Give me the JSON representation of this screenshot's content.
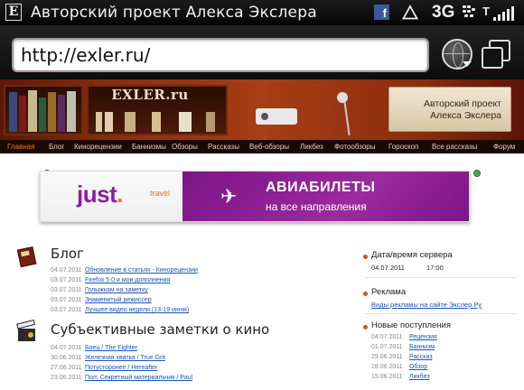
{
  "status_bar": {
    "app_title": "Авторский проект Алекса Экслера",
    "facebook_label": "f",
    "network_label": "3G"
  },
  "browser": {
    "url": "http://exler.ru/"
  },
  "header": {
    "logo": "EXLER.ru",
    "caption_line1": "Авторский проект",
    "caption_line2": "Алекса Экслера"
  },
  "nav": {
    "items": [
      {
        "label": "Главная",
        "active": true
      },
      {
        "label": "Блог"
      },
      {
        "label": "Кинорецензии"
      },
      {
        "label": "Баннизмы"
      },
      {
        "label": "Обзоры"
      },
      {
        "label": "Рассказы"
      },
      {
        "label": "Веб-обзоры"
      },
      {
        "label": "Ликбез"
      },
      {
        "label": "Фотообзоры"
      },
      {
        "label": "Гороскоп"
      },
      {
        "label": "Все рассказы"
      },
      {
        "label": "Форум"
      }
    ]
  },
  "ad": {
    "logo_main": "just",
    "logo_dot": ".",
    "logo_sub": "travel",
    "title": "АВИАБИЛЕТЫ",
    "subtitle": "на все направления",
    "plane_icon": "airplane-icon"
  },
  "blog": {
    "title": "Блог",
    "posts": [
      {
        "date": "04.07.2011",
        "title": "Обновление в статьях - Кинорецензии"
      },
      {
        "date": "03.07.2011",
        "title": "Firefox 5.0 и мои дополнения"
      },
      {
        "date": "03.07.2011",
        "title": "Голыжкам на заметку"
      },
      {
        "date": "03.07.2011",
        "title": "Знаменитый режиссер"
      },
      {
        "date": "03.07.2011",
        "title": "Лучшее видео недели (13-19 июня)"
      }
    ]
  },
  "movies": {
    "title": "Субъективные заметки о кино",
    "posts": [
      {
        "date": "04.07.2011",
        "title": "Боец / The Fighter"
      },
      {
        "date": "30.06.2011",
        "title": "Железная хватка / True Grit"
      },
      {
        "date": "27.06.2011",
        "title": "Потусторонее / Hereafter"
      },
      {
        "date": "23.06.2011",
        "title": "Пол: Секретный материальчик / Paul"
      }
    ]
  },
  "sidebar": {
    "server_time": {
      "title": "Дата/время сервера",
      "date": "04.07.2011",
      "time": "17:00"
    },
    "ads": {
      "title": "Реклама",
      "link": "Виды рекламы на сайте Экслер.Ру"
    },
    "new_items": {
      "title": "Новые поступления",
      "rows": [
        {
          "date": "04.07.2011",
          "label": "Рецензия"
        },
        {
          "date": "01.07.2011",
          "label": "Баннизм"
        },
        {
          "date": "29.06.2011",
          "label": "Рассказ"
        },
        {
          "date": "28.06.2011",
          "label": "Обзор"
        },
        {
          "date": "15.06.2011",
          "label": "Ликбез"
        }
      ]
    }
  },
  "colors": {
    "link": "#1a55b5",
    "nav_active": "#f07a1a",
    "ad_purple": "#8b1da0",
    "ad_orange": "#e8731e",
    "bullet": "#d8541b"
  }
}
